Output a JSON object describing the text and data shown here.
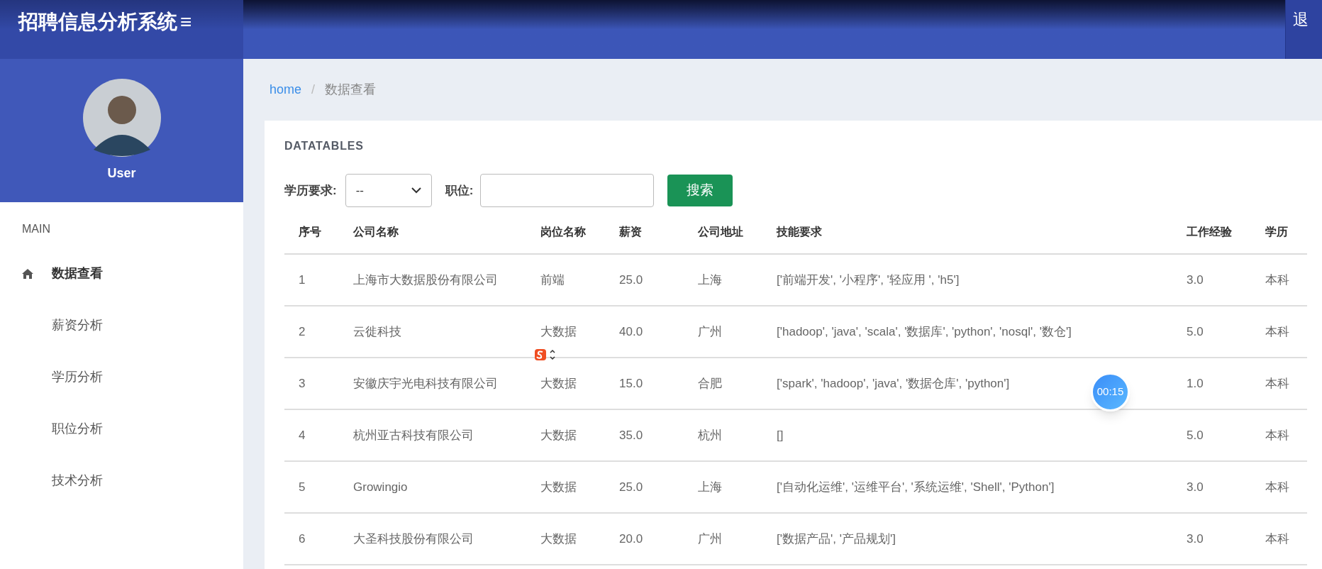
{
  "header": {
    "title": "招聘信息分析系统",
    "menu_glyph": "≡",
    "logout": "退"
  },
  "profile": {
    "name": "User"
  },
  "sidebar": {
    "section": "MAIN",
    "items": [
      {
        "label": "数据查看",
        "selected": true
      },
      {
        "label": "薪资分析",
        "selected": false
      },
      {
        "label": "学历分析",
        "selected": false
      },
      {
        "label": "职位分析",
        "selected": false
      },
      {
        "label": "技术分析",
        "selected": false
      }
    ]
  },
  "breadcrumb": [
    {
      "label": "home",
      "kind": "link"
    },
    {
      "label": "/",
      "kind": "separator"
    },
    {
      "label": "数据查看",
      "kind": "current"
    }
  ],
  "card": {
    "title": "DATATABLES"
  },
  "filters": {
    "education_label": "学历要求:",
    "education_value": "--",
    "position_label": "职位:",
    "search_button": "搜索"
  },
  "table": {
    "columns": [
      "序号",
      "公司名称",
      "岗位名称",
      "薪资",
      "公司地址",
      "技能要求",
      "工作经验",
      "学历"
    ],
    "rows": [
      [
        "1",
        "上海市大数据股份有限公司",
        "前端",
        "25.0",
        "上海",
        "['前端开发', '小程序', '轻应用 ', 'h5']",
        "3.0",
        "本科"
      ],
      [
        "2",
        "云徙科技",
        "大数据",
        "40.0",
        "广州",
        "['hadoop', 'java', 'scala', '数据库', 'python', 'nosql', '数仓']",
        "5.0",
        "本科"
      ],
      [
        "3",
        "安徽庆宇光电科技有限公司",
        "大数据",
        "15.0",
        "合肥",
        "['spark', 'hadoop', 'java', '数据仓库', 'python']",
        "1.0",
        "本科"
      ],
      [
        "4",
        "杭州亚古科技有限公司",
        "大数据",
        "35.0",
        "杭州",
        "[]",
        "5.0",
        "本科"
      ],
      [
        "5",
        "Growingio",
        "大数据",
        "25.0",
        "上海",
        "['自动化运维', '运维平台', '系统运维', 'Shell', 'Python']",
        "3.0",
        "本科"
      ],
      [
        "6",
        "大圣科技股份有限公司",
        "大数据",
        "20.0",
        "广州",
        "['数据产品', '产品规划']",
        "3.0",
        "本科"
      ]
    ]
  },
  "timer": {
    "text": "00:15"
  }
}
